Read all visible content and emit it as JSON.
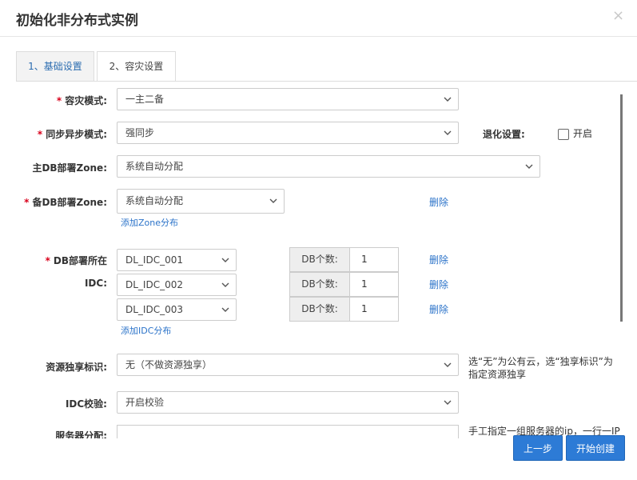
{
  "dialog": {
    "title": "初始化非分布式实例",
    "close_label": "×"
  },
  "tabs": [
    {
      "label": "1、基础设置"
    },
    {
      "label": "2、容灾设置"
    }
  ],
  "form": {
    "dr_mode": {
      "label": "容灾模式:",
      "value": "一主二备"
    },
    "sync_mode": {
      "label": "同步异步模式:",
      "value": "强同步"
    },
    "degrade": {
      "label": "退化设置:",
      "checkbox_label": "开启",
      "checked": false
    },
    "master_zone": {
      "label": "主DB部署Zone:",
      "value": "系统自动分配"
    },
    "standby_zone": {
      "label": "备DB部署Zone:",
      "value": "系统自动分配",
      "delete_label": "删除",
      "add_label": "添加Zone分布"
    },
    "idc": {
      "label_line1": "DB部署所在",
      "label_line2": "IDC:",
      "count_label": "DB个数:",
      "delete_label": "删除",
      "add_label": "添加IDC分布",
      "rows": [
        {
          "idc": "DL_IDC_001",
          "count": "1"
        },
        {
          "idc": "DL_IDC_002",
          "count": "1"
        },
        {
          "idc": "DL_IDC_003",
          "count": "1"
        }
      ]
    },
    "resource": {
      "label": "资源独享标识:",
      "value": "无（不做资源独享）",
      "hint": "选“无”为公有云，选“独享标识”为指定资源独享"
    },
    "idc_check": {
      "label": "IDC校验:",
      "value": "开启校验"
    },
    "server_alloc": {
      "label": "服务器分配:",
      "hint": "手工指定一组服务器的ip，一行一IP"
    }
  },
  "footer": {
    "prev_label": "上一步",
    "start_label": "开始创建"
  }
}
